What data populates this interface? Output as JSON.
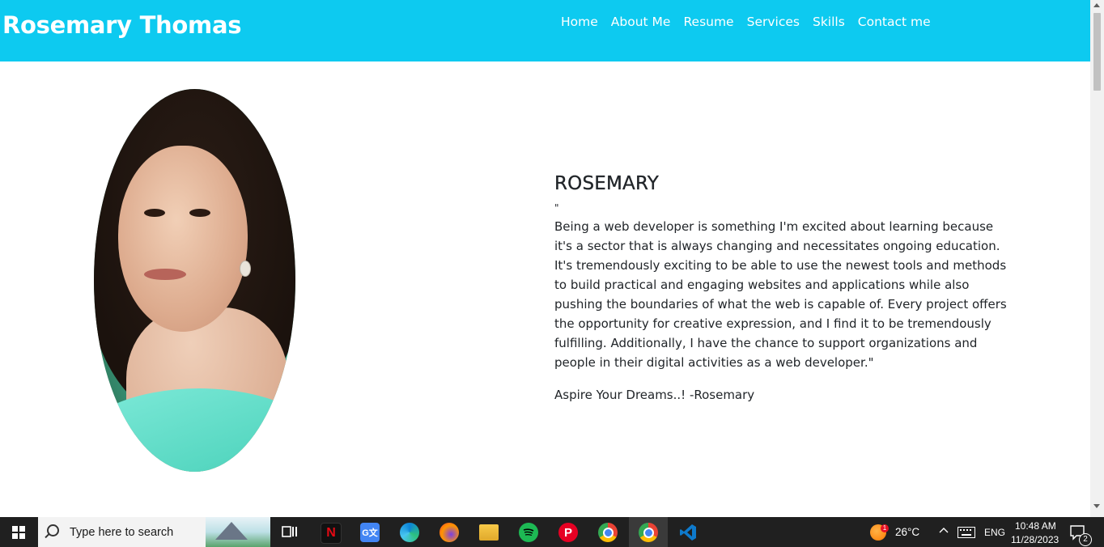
{
  "navbar": {
    "brand": "Rosemary Thomas",
    "links": [
      "Home",
      "About Me",
      "Resume",
      "Services",
      "Skills",
      "Contact me"
    ]
  },
  "about": {
    "heading": "ROSEMARY",
    "quote_open": "\"",
    "body": "Being a web developer is something I'm excited about learning because it's a sector that is always changing and necessitates ongoing education. It's tremendously exciting to be able to use the newest tools and methods to build practical and engaging websites and applications while also pushing the boundaries of what the web is capable of. Every project offers the opportunity for creative expression, and I find it to be tremendously fulfilling. Additionally, I have the chance to support organizations and people in their digital activities as a web developer.\"",
    "tagline": "Aspire Your Dreams..! -Rosemary"
  },
  "taskbar": {
    "search_placeholder": "Type here to search",
    "apps": [
      "task-view-icon",
      "netflix-icon",
      "google-translate-icon",
      "edge-icon",
      "firefox-icon",
      "file-explorer-icon",
      "spotify-icon",
      "pinterest-icon",
      "chrome-icon",
      "chrome-profile-icon",
      "vscode-icon"
    ],
    "weather": "26°C",
    "weather_badge": "1",
    "language": "ENG",
    "time": "10:48 AM",
    "date": "11/28/2023",
    "notifications": "2"
  },
  "colors": {
    "navbar_bg": "#0dcaf0",
    "taskbar_bg": "#202020"
  }
}
